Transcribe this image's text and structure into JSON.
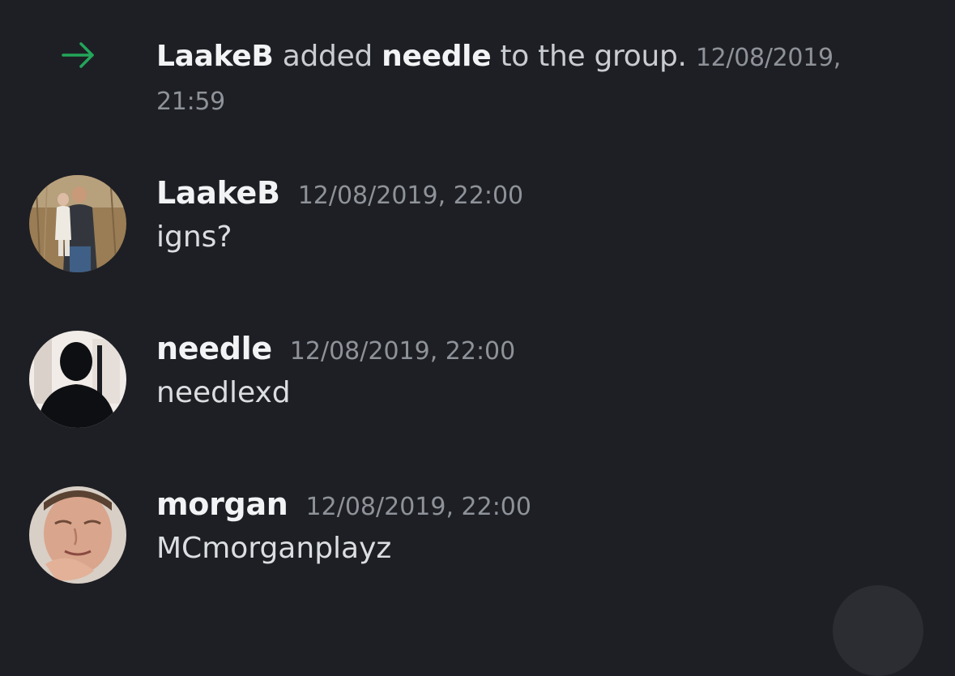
{
  "system_message": {
    "actor": "LaakeB",
    "text_added": "added",
    "target": "needle",
    "text_suffix": "to the group.",
    "timestamp_date": "12/08/2019,",
    "timestamp_time": "21:59",
    "icon": "arrow-right-icon",
    "icon_color": "#23a55a"
  },
  "messages": [
    {
      "author": "LaakeB",
      "timestamp": "12/08/2019, 22:00",
      "content": "igns?",
      "avatar": "photo-man-holding-child"
    },
    {
      "author": "needle",
      "timestamp": "12/08/2019, 22:00",
      "content": "needlexd",
      "avatar": "photo-silhouette"
    },
    {
      "author": "morgan",
      "timestamp": "12/08/2019, 22:00",
      "content": "MCmorganplayz",
      "avatar": "photo-face-closeup"
    }
  ],
  "colors": {
    "background": "#1e1f24",
    "text_primary": "#f2f3f5",
    "text_secondary": "#dbdee1",
    "timestamp": "#8e9299"
  }
}
